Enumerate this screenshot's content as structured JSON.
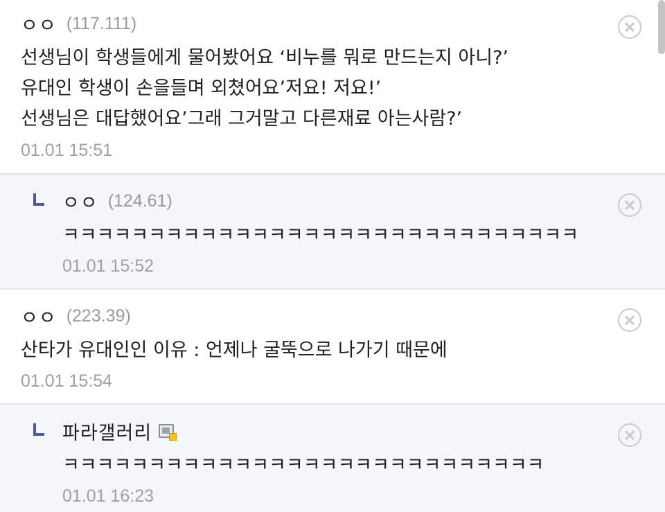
{
  "comments": [
    {
      "nickname": "ㅇㅇ",
      "ip": "(117.111)",
      "lines": [
        "선생님이 학생들에게 물어봤어요 ‘비누를 뭐로 만드는지 아니?’",
        "유대인 학생이 손을들며 외쳤어요’저요! 저요!’",
        "선생님은 대답했어요’그래 그거말고 다른재료 아는사람?’"
      ],
      "time": "01.01 15:51"
    },
    {
      "nickname": "ㅇㅇ",
      "ip": "(124.61)",
      "lines": [
        "ㅋㅋㅋㅋㅋㅋㅋㅋㅋㅋㅋㅋㅋㅋㅋㅋㅋㅋㅋㅋㅋㅋㅋㅋㅋㅋㅋㅋㅋㅋ"
      ],
      "time": "01.01 15:52"
    },
    {
      "nickname": "ㅇㅇ",
      "ip": "(223.39)",
      "lines": [
        "산타가 유대인인 이유 : 언제나 굴뚝으로 나가기 때문에"
      ],
      "time": "01.01 15:54"
    },
    {
      "nickname": "파라갤러리",
      "icon": "gallery-member-icon",
      "lines": [
        "ㅋㅋㅋㅋㅋㅋㅋㅋㅋㅋㅋㅋㅋㅋㅋㅋㅋㅋㅋㅋㅋㅋㅋㅋㅋㅋㅋㅋ"
      ],
      "time": "01.01 16:23"
    }
  ],
  "icons": {
    "reply": "reply-arrow-icon",
    "delete": "delete-circle-x-icon"
  },
  "colors": {
    "reply_background": "#f5f6f9",
    "reply_marker": "#4a5aa8",
    "meta_text": "#9a9a9a"
  }
}
